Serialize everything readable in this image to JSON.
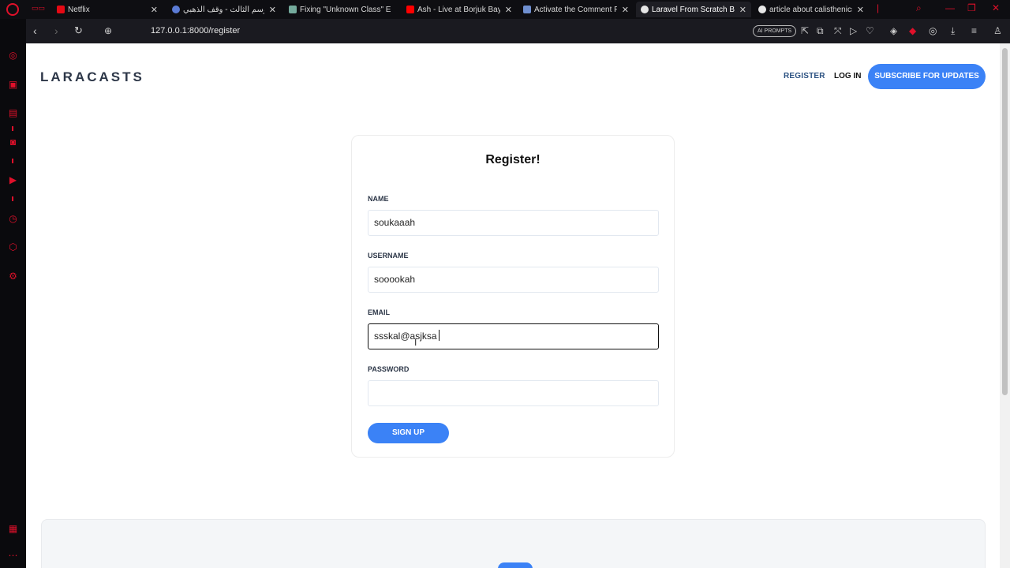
{
  "browser": {
    "workspace_icon": "opera-logo-icon",
    "tabs": [
      {
        "title": "Netflix",
        "active": false
      },
      {
        "title": "الموسم الثالث - وقف الذهبي",
        "active": false
      },
      {
        "title": "Fixing \"Unknown Class\" E",
        "active": false
      },
      {
        "title": "Ash - Live at Borjuk Bay",
        "active": false
      },
      {
        "title": "Activate the Comment Fo",
        "active": false
      },
      {
        "title": "Laravel From Scratch Blo",
        "active": true
      },
      {
        "title": "article about calisthenics",
        "active": false
      }
    ],
    "url": "127.0.0.1:8000/register",
    "ai_prompts_label": "AI PROMPTS",
    "accent_color": "#e0102a"
  },
  "site": {
    "logo": "LARACASTS",
    "nav": {
      "register": "REGISTER",
      "login": "LOG IN",
      "subscribe": "SUBSCRIBE FOR UPDATES"
    },
    "accent_color": "#3b82f6"
  },
  "form": {
    "title": "Register!",
    "fields": {
      "name": {
        "label": "NAME",
        "value": "soukaaah"
      },
      "username": {
        "label": "USERNAME",
        "value": "sooookah"
      },
      "email": {
        "label": "EMAIL",
        "value": "ssskal@asjksa"
      },
      "password": {
        "label": "PASSWORD",
        "value": ""
      }
    },
    "submit": "SIGN UP"
  }
}
